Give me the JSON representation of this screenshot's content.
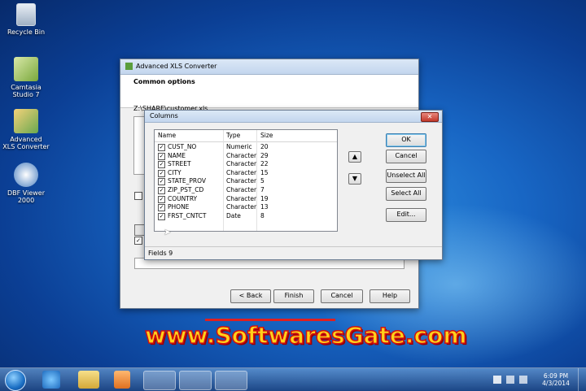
{
  "desktop": {
    "icons": [
      {
        "label": "Recycle Bin"
      },
      {
        "label": "Camtasia\nStudio 7"
      },
      {
        "label": "Advanced\nXLS Converter"
      },
      {
        "label": "DBF Viewer\n2000"
      }
    ]
  },
  "main_window": {
    "title": "Advanced XLS Converter",
    "section_title": "Common options",
    "path_text": "Z:\\SHARE\\customer.xls",
    "buttons": {
      "back": "< Back",
      "finish": "Finish",
      "cancel": "Cancel",
      "help": "Help"
    }
  },
  "columns_dialog": {
    "title": "Columns",
    "headers": {
      "name": "Name",
      "type": "Type",
      "size": "Size"
    },
    "rows": [
      {
        "name": "CUST_NO",
        "type": "Numeric",
        "size": "20",
        "checked": true
      },
      {
        "name": "NAME",
        "type": "Character",
        "size": "29",
        "checked": true
      },
      {
        "name": "STREET",
        "type": "Character",
        "size": "22",
        "checked": true
      },
      {
        "name": "CITY",
        "type": "Character",
        "size": "15",
        "checked": true
      },
      {
        "name": "STATE_PROV",
        "type": "Character",
        "size": "5",
        "checked": true
      },
      {
        "name": "ZIP_PST_CD",
        "type": "Character",
        "size": "7",
        "checked": true
      },
      {
        "name": "COUNTRY",
        "type": "Character",
        "size": "19",
        "checked": true
      },
      {
        "name": "PHONE",
        "type": "Character",
        "size": "13",
        "checked": true
      },
      {
        "name": "FRST_CNTCT",
        "type": "Date",
        "size": "8",
        "checked": true
      }
    ],
    "buttons": {
      "ok": "OK",
      "cancel": "Cancel",
      "unselect_all": "Unselect All",
      "select_all": "Select All",
      "edit": "Edit..."
    },
    "status": "Fields 9"
  },
  "taskbar": {
    "time": "6:09 PM",
    "date": "4/3/2014"
  },
  "watermark": "www.SoftwaresGate.com"
}
